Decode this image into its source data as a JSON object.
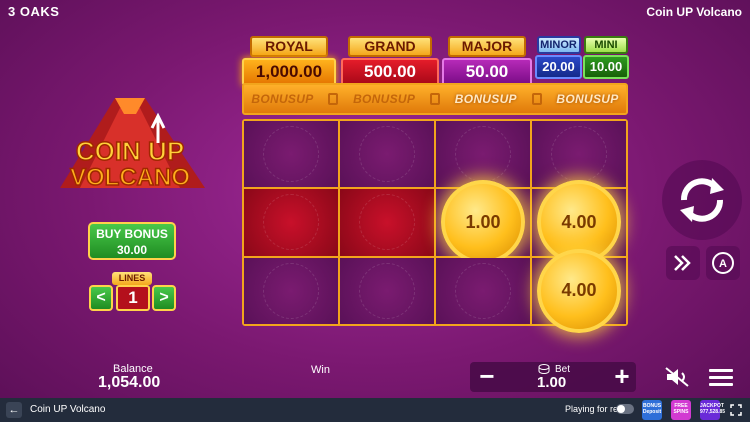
{
  "header": {
    "brand": "3 OAKS",
    "game_title": "Coin UP Volcano"
  },
  "jackpots": {
    "royal": {
      "label": "ROYAL",
      "value": "1,000.00"
    },
    "grand": {
      "label": "GRAND",
      "value": "500.00"
    },
    "major": {
      "label": "MAJOR",
      "value": "50.00"
    },
    "minor": {
      "label": "MINOR",
      "value": "20.00"
    },
    "mini": {
      "label": "MINI",
      "value": "10.00"
    }
  },
  "bonus_strip": [
    "BONUSUP",
    "BONUSUP",
    "BONUSUP",
    "BONUSUP"
  ],
  "logo": {
    "line1": "COIN UP",
    "line2": "VOLCANO"
  },
  "buy_bonus": {
    "label": "BUY BONUS",
    "price": "30.00"
  },
  "lines": {
    "label": "LINES",
    "value": "1",
    "prev": "<",
    "next": ">"
  },
  "grid": {
    "cells": [
      {
        "type": "empty"
      },
      {
        "type": "empty"
      },
      {
        "type": "empty"
      },
      {
        "type": "empty"
      },
      {
        "type": "red"
      },
      {
        "type": "red"
      },
      {
        "type": "coin",
        "value": "1.00"
      },
      {
        "type": "coin",
        "value": "4.00"
      },
      {
        "type": "empty"
      },
      {
        "type": "empty"
      },
      {
        "type": "empty"
      },
      {
        "type": "coin",
        "value": "4.00"
      }
    ]
  },
  "footer": {
    "balance_label": "Balance",
    "balance_value": "1,054.00",
    "win_label": "Win",
    "bet_label": "Bet",
    "bet_value": "1.00",
    "bet_minus": "−",
    "bet_plus": "+"
  },
  "bottom_bar": {
    "back": "←",
    "game_name": "Coin UP Volcano",
    "play_real": "Playing for real",
    "badges": [
      {
        "top": "BONUS",
        "bottom": "Deposit",
        "color": "#2f6fd8"
      },
      {
        "top": "FREE",
        "bottom": "SPINS",
        "color": "#d23ad2"
      },
      {
        "top": "JACKPOT",
        "bottom": "977,528.85",
        "color": "#6a2ad8"
      }
    ]
  },
  "colors": {
    "accent_gold": "#f2a51c",
    "background": "#7a1870"
  }
}
